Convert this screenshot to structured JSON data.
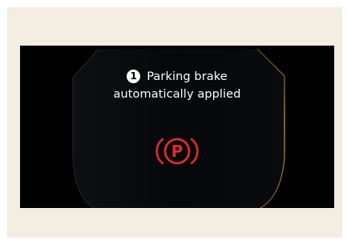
{
  "warning": {
    "badge_number": "1",
    "line1": "Parking brake",
    "line2": "automatically applied",
    "icon_name": "parking-brake-icon",
    "icon_letter": "P",
    "icon_color": "#e42a2a",
    "text_color": "#ffffff",
    "border_color": "#c8903a"
  }
}
